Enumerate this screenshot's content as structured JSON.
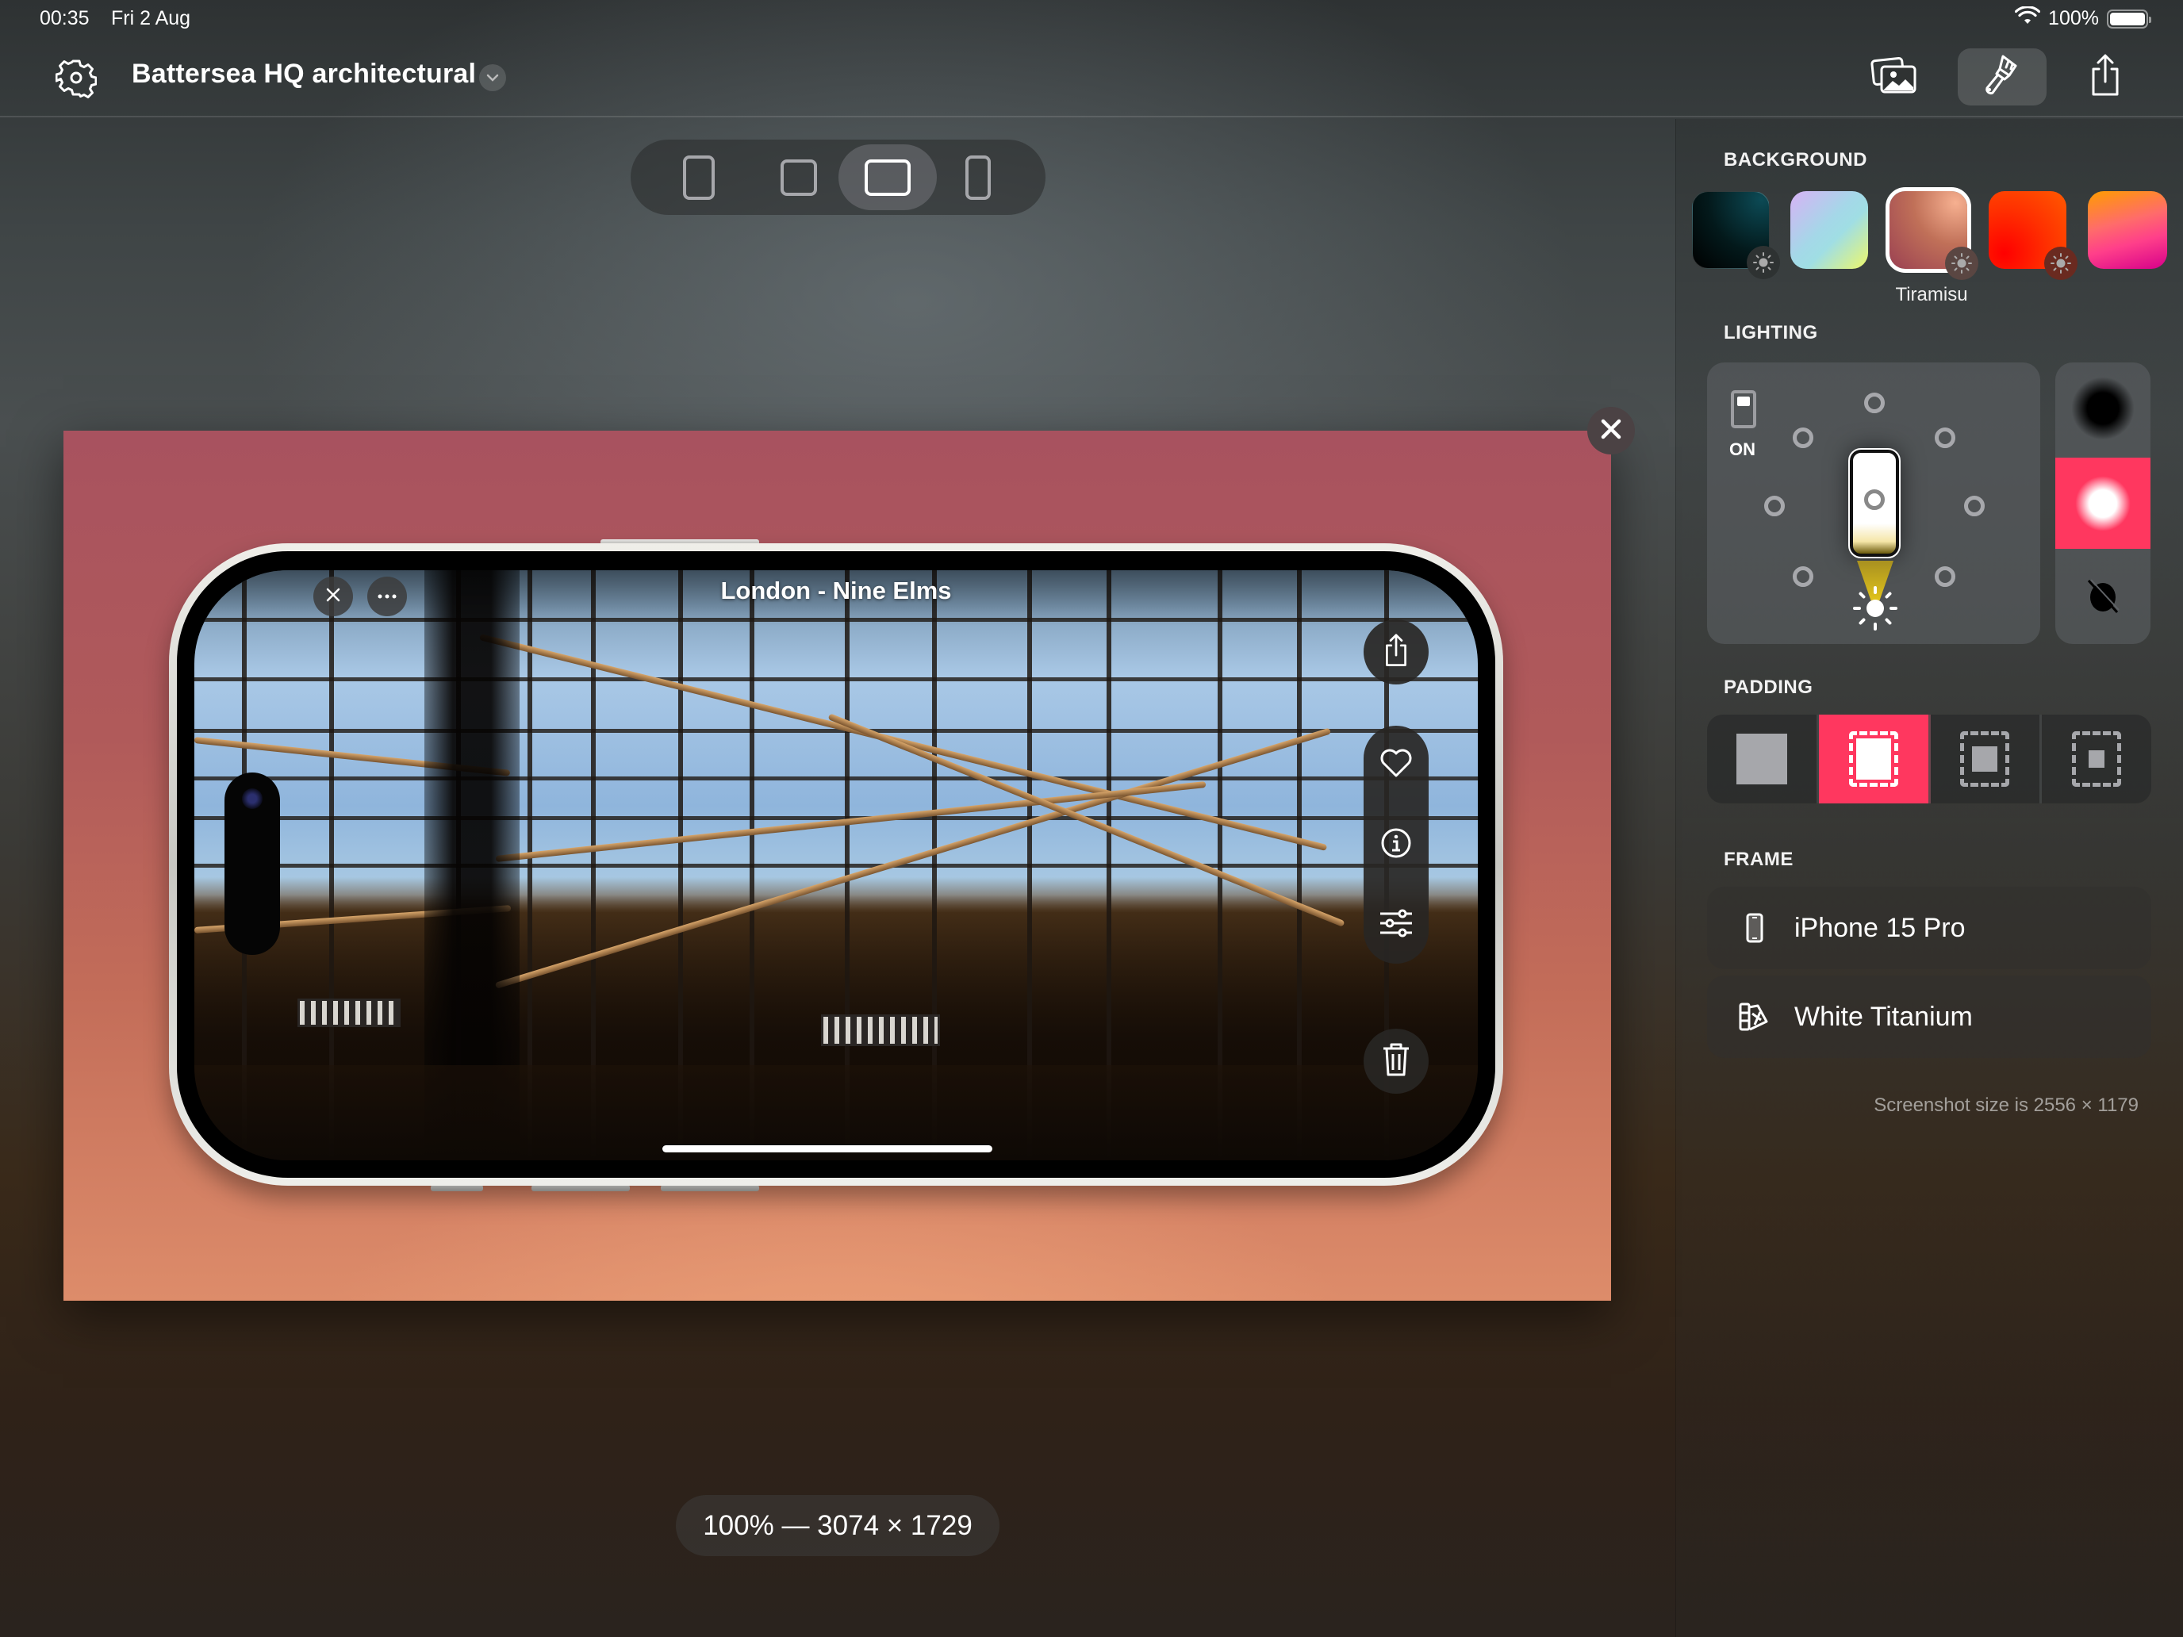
{
  "status_bar": {
    "time": "00:35",
    "date": "Fri 2 Aug",
    "battery_text": "100%",
    "battery_level": 1.0,
    "wifi_icon": "wifi-icon"
  },
  "toolbar": {
    "settings_icon": "gear-icon",
    "document_title": "Battersea HQ architectural",
    "title_menu_icon": "chevron-down-icon",
    "buttons": [
      {
        "name": "photos",
        "icon": "photo-stack-icon",
        "active": false
      },
      {
        "name": "style",
        "icon": "paintbrush-icon",
        "active": true
      },
      {
        "name": "share",
        "icon": "share-icon",
        "active": false
      }
    ]
  },
  "device_selector": {
    "options": [
      {
        "name": "portrait",
        "icon": "tablet-portrait-icon",
        "selected": false
      },
      {
        "name": "square",
        "icon": "square-icon",
        "selected": false
      },
      {
        "name": "landscape",
        "icon": "landscape-icon",
        "selected": true
      },
      {
        "name": "phone",
        "icon": "phone-icon",
        "selected": false
      }
    ]
  },
  "canvas": {
    "close_icon": "close-icon",
    "screenshot": {
      "title": "London - Nine Elms",
      "controls": {
        "close_icon": "close-icon",
        "more_icon": "ellipsis-icon",
        "share_icon": "share-icon",
        "favorite_icon": "heart-icon",
        "info_icon": "info-icon",
        "adjust_icon": "sliders-icon",
        "delete_icon": "trash-icon"
      }
    }
  },
  "zoom_readout": "100% — 3074 × 1729",
  "sidebar": {
    "background": {
      "label": "BACKGROUND",
      "selected_name": "Tiramisu",
      "swatches": [
        {
          "name": "dark-teal",
          "colors": [
            "#021010",
            "#0a4450"
          ],
          "has_light_badge": true,
          "selected": false
        },
        {
          "name": "pastel",
          "colors": [
            "#d2b4f2",
            "#9fdce6",
            "#eef86a"
          ],
          "has_light_badge": false,
          "selected": false
        },
        {
          "name": "Tiramisu",
          "colors": [
            "#f0a888",
            "#b66a56",
            "#9a4050"
          ],
          "has_light_badge": true,
          "selected": true
        },
        {
          "name": "red-orange",
          "colors": [
            "#ff1a00",
            "#ff5a00"
          ],
          "has_light_badge": true,
          "selected": false
        },
        {
          "name": "sunset-pink",
          "colors": [
            "#ff9a00",
            "#ff6a7a",
            "#e6008c"
          ],
          "has_light_badge": false,
          "selected": false
        }
      ]
    },
    "lighting": {
      "label": "LIGHTING",
      "toggle_label": "ON",
      "toggle_on": true,
      "position": "bottom",
      "shadow_options": [
        {
          "name": "dark-shadow",
          "icon": "shadow-dark-icon",
          "selected": false
        },
        {
          "name": "glow",
          "icon": "glow-icon",
          "selected": true
        },
        {
          "name": "no-shadow",
          "icon": "no-shadow-icon",
          "selected": false
        }
      ],
      "accent_color": "#ff375f"
    },
    "padding": {
      "label": "PADDING",
      "options": [
        {
          "name": "none",
          "selected": false
        },
        {
          "name": "small",
          "selected": true
        },
        {
          "name": "medium",
          "selected": false
        },
        {
          "name": "large",
          "selected": false
        }
      ]
    },
    "frame": {
      "label": "FRAME",
      "device": "iPhone 15 Pro",
      "device_icon": "iphone-icon",
      "color": "White Titanium",
      "color_icon": "color-swatches-icon"
    },
    "screenshot_size_note": "Screenshot size is 2556 × 1179"
  }
}
